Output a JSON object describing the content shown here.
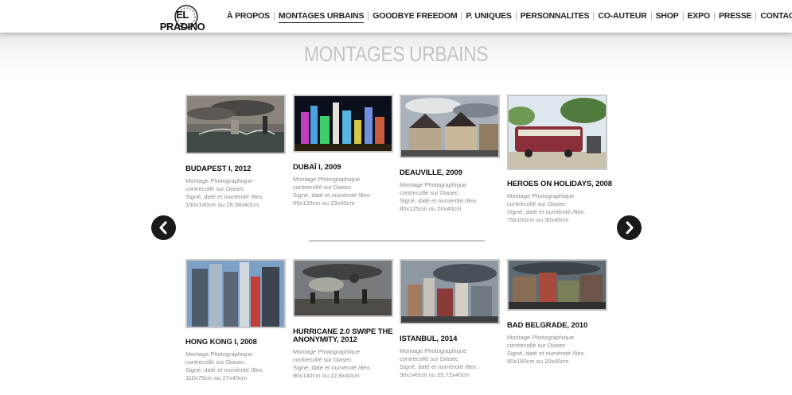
{
  "logo": {
    "text": "EL PRADINO"
  },
  "nav": {
    "items": [
      {
        "label": "À PROPOS",
        "active": false
      },
      {
        "label": "MONTAGES URBAINS",
        "active": true
      },
      {
        "label": "GOODBYE FREEDOM",
        "active": false
      },
      {
        "label": "P. UNIQUES",
        "active": false
      },
      {
        "label": "PERSONNALITES",
        "active": false
      },
      {
        "label": "CO-AUTEUR",
        "active": false
      },
      {
        "label": "SHOP",
        "active": false
      },
      {
        "label": "EXPO",
        "active": false
      },
      {
        "label": "PRESSE",
        "active": false
      },
      {
        "label": "CONTACT",
        "active": false
      }
    ]
  },
  "page": {
    "title": "MONTAGES URBAINS"
  },
  "carousel": {
    "prev_icon": "chevron-left-icon",
    "next_icon": "chevron-right-icon"
  },
  "works": [
    {
      "title": "BUDAPEST I, 2012",
      "desc": [
        "Montage Photographique",
        "contrecollé sur Diasec",
        "Signé, daté et numéroté /8ex.",
        "100x140cm ou 28,58x40cm"
      ]
    },
    {
      "title": "DUBAÏ I, 2009",
      "desc": [
        "Montage Photographique",
        "contrecollé sur Diasec",
        "Signé, daté et numéroté /8ex.",
        "69x120cm ou 23x40cm"
      ]
    },
    {
      "title": "DEAUVILLE, 2009",
      "desc": [
        "Montage Photographique",
        "contrecollé sur Diasec",
        "Signé, daté et numéroté /8ex.",
        "80x125cm ou 26x40cm"
      ]
    },
    {
      "title": "HEROES ON HOLIDAYS, 2008",
      "desc": [
        "Montage Photographique",
        "contrecollé sur Diasec",
        "Signé, daté et numéroté /8ex.",
        "75x100cm ou 30x40cm"
      ]
    },
    {
      "title": "HONG KONG I, 2008",
      "desc": [
        "Montage Photographique",
        "contrecollé sur Diasec.",
        "Signé, daté et numéroté /8ex.",
        "110x75cm ou 27x40cm"
      ]
    },
    {
      "title": "HURRICANE 2.0 SWIPE THE ANONYMITY, 2012",
      "desc": [
        "Montage Photographique",
        "contrecollé sur Diasec",
        "Signé, daté et numéroté /8ex.",
        "80x140cm ou 22,8x40cm"
      ]
    },
    {
      "title": "ISTANBUL, 2014",
      "desc": [
        "Montage Photographique",
        "contrecollé sur Diasec",
        "Signé, daté et numéroté /8ex.",
        "90x140cm ou 25,72x40cm"
      ]
    },
    {
      "title": "BAD BELGRADE, 2010",
      "desc": [
        "Montage Photographique",
        "contrecollé sur Diasec",
        "Signé, daté et numéroté /8ex.",
        "80x160cm ou 20x40cm"
      ]
    }
  ]
}
